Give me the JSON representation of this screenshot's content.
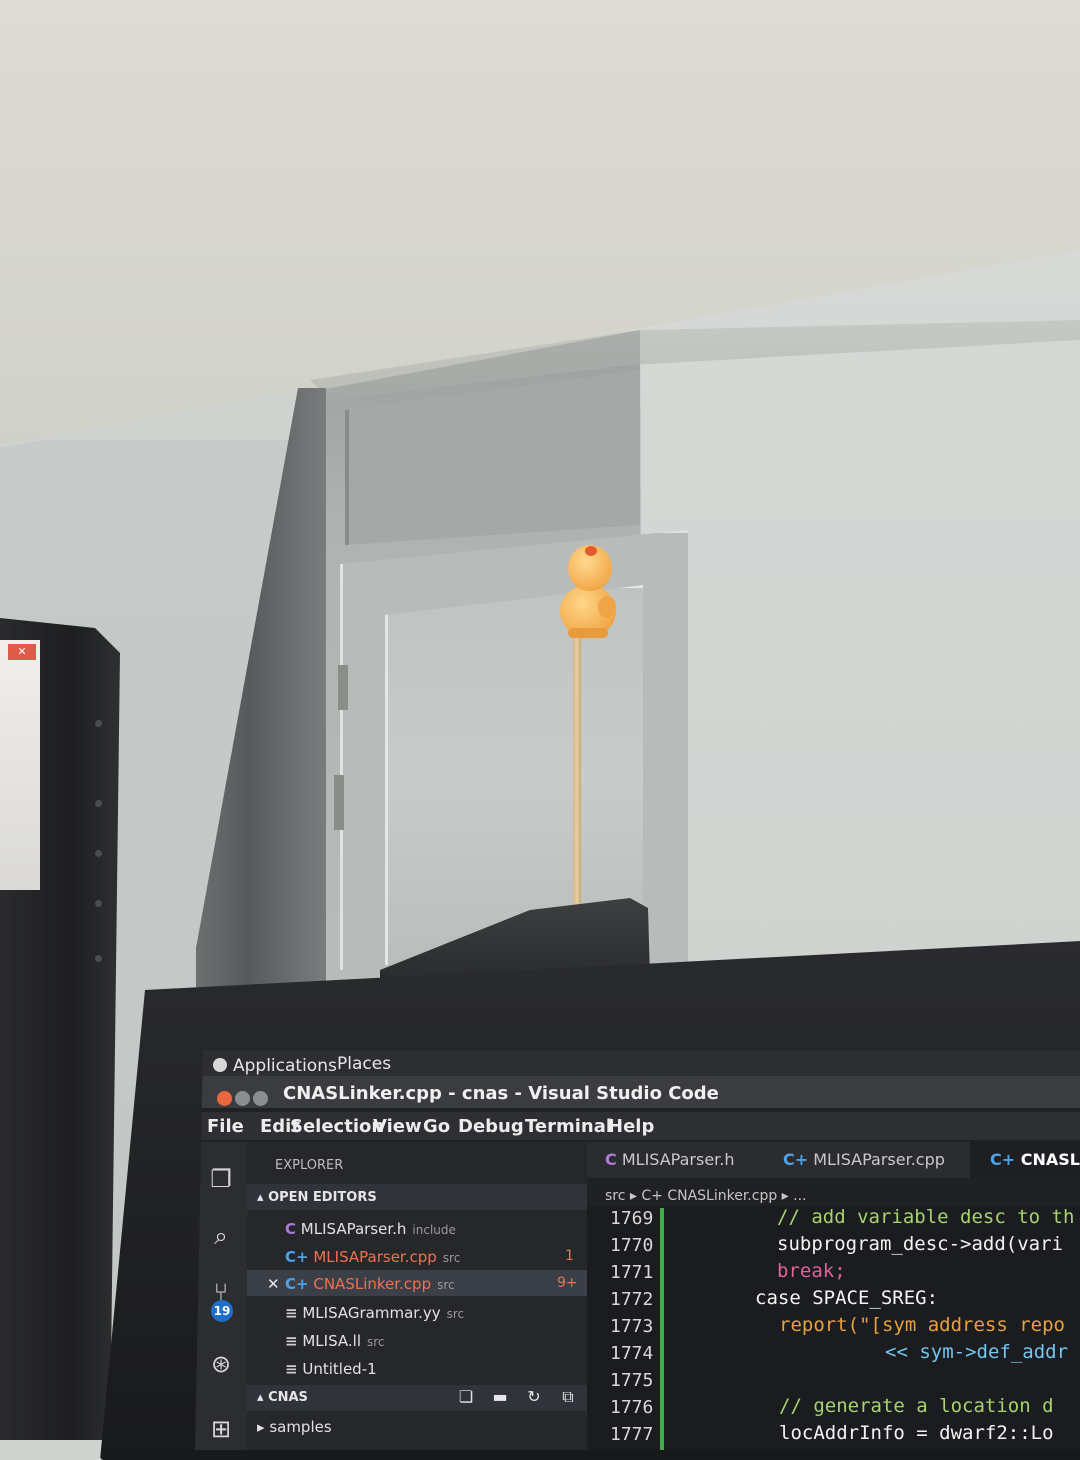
{
  "panel": {
    "applications": "Applications",
    "places": "Places"
  },
  "window": {
    "title": "CNASLinker.cpp - cnas - Visual Studio Code"
  },
  "menu": [
    "File",
    "Edit",
    "Selection",
    "View",
    "Go",
    "Debug",
    "Terminal",
    "Help"
  ],
  "activity": {
    "scm_badge": "19"
  },
  "sidebar": {
    "explorer_title": "EXPLORER",
    "open_editors_label": "OPEN EDITORS",
    "open_editors": [
      {
        "icon": "C",
        "name": "MLISAParser.h",
        "desc": "include",
        "badge": ""
      },
      {
        "icon": "C+",
        "name": "MLISAParser.cpp",
        "desc": "src",
        "badge": "1"
      },
      {
        "icon": "C+",
        "name": "CNASLinker.cpp",
        "desc": "src",
        "badge": "9+"
      },
      {
        "icon": "≡",
        "name": "MLISAGrammar.yy",
        "desc": "src",
        "badge": ""
      },
      {
        "icon": "≡",
        "name": "MLISA.ll",
        "desc": "src",
        "badge": ""
      },
      {
        "icon": "≡",
        "name": "Untitled-1",
        "desc": "",
        "badge": ""
      }
    ],
    "workspace_label": "CNAS",
    "folders": [
      "samples"
    ]
  },
  "tabs": [
    {
      "icon": "C",
      "label": "MLISAParser.h"
    },
    {
      "icon": "C+",
      "label": "MLISAParser.cpp"
    },
    {
      "icon": "C+",
      "label": "CNASLin"
    }
  ],
  "breadcrumb": {
    "text": "src ▸  C+ CNASLinker.cpp ▸ ..."
  },
  "editor": {
    "lines": [
      {
        "num": "1769",
        "text": "// add variable desc to th"
      },
      {
        "num": "1770",
        "text": "subprogram_desc->add(vari"
      },
      {
        "num": "1771",
        "text": "break;"
      },
      {
        "num": "1772",
        "text": "case SPACE_SREG:"
      },
      {
        "num": "1773",
        "text": "report(\"[sym address repo"
      },
      {
        "num": "1774",
        "text": "<< sym->def_addr"
      },
      {
        "num": "1775",
        "text": ""
      },
      {
        "num": "1776",
        "text": "// generate a location d"
      },
      {
        "num": "1777",
        "text": "locAddrInfo = dwarf2::Lo"
      }
    ]
  },
  "colors": {
    "comment": "#a5d36d",
    "keyword": "#e0629a",
    "string": "#e7a13e",
    "gutter_modified": "#3fae47",
    "close_button": "#e9673d",
    "figure": "#f1a94a"
  }
}
